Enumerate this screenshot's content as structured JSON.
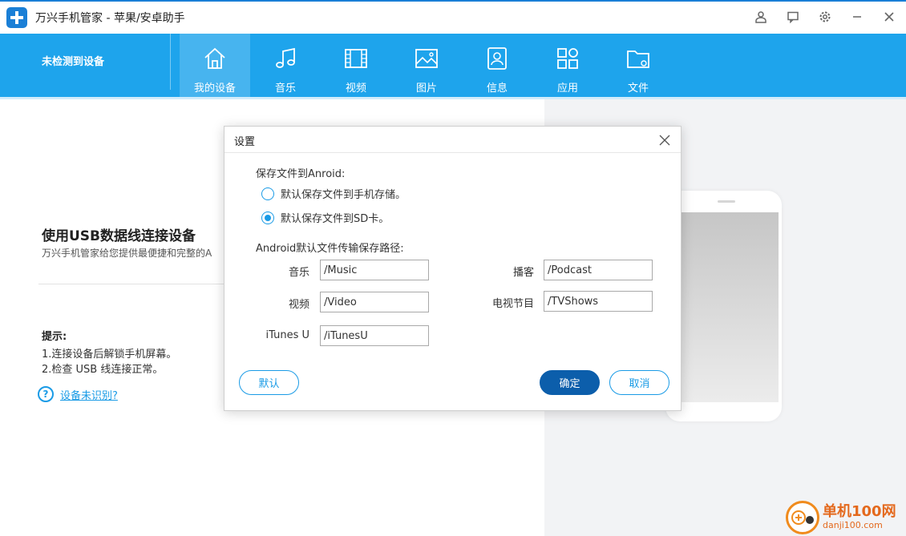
{
  "app": {
    "title": "万兴手机管家 - 苹果/安卓助手"
  },
  "window_controls": [
    {
      "name": "account-icon"
    },
    {
      "name": "feedback-icon"
    },
    {
      "name": "settings-icon"
    },
    {
      "name": "minimize-icon"
    },
    {
      "name": "close-icon"
    }
  ],
  "navbar": {
    "device_status": "未检测到设备",
    "tabs": [
      {
        "label": "我的设备",
        "icon": "home-icon",
        "active": true
      },
      {
        "label": "音乐",
        "icon": "music-icon",
        "active": false
      },
      {
        "label": "视频",
        "icon": "video-icon",
        "active": false
      },
      {
        "label": "图片",
        "icon": "photo-icon",
        "active": false
      },
      {
        "label": "信息",
        "icon": "contacts-icon",
        "active": false
      },
      {
        "label": "应用",
        "icon": "apps-icon",
        "active": false
      },
      {
        "label": "文件",
        "icon": "folder-icon",
        "active": false
      }
    ]
  },
  "main": {
    "connect_title": "使用USB数据线连接设备",
    "connect_desc": "万兴手机管家给您提供最便捷和完整的A",
    "tips_title": "提示:",
    "tips": [
      "1.连接设备后解锁手机屏幕。",
      "2.检查 USB 线连接正常。"
    ],
    "help_link": "设备未识别?"
  },
  "dialog": {
    "title": "设置",
    "save_section_label": "保存文件到Anroid:",
    "radio_options": [
      {
        "label": "默认保存文件到手机存储。",
        "checked": false
      },
      {
        "label": "默认保存文件到SD卡。",
        "checked": true
      }
    ],
    "path_section_label": "Android默认文件传输保存路径:",
    "fields": {
      "music": {
        "label": "音乐",
        "value": "/Music"
      },
      "video": {
        "label": "视频",
        "value": "/Video"
      },
      "itunesu": {
        "label": "iTunes U",
        "value": "/iTunesU"
      },
      "podcast": {
        "label": "播客",
        "value": "/Podcast"
      },
      "tvshows": {
        "label": "电视节目",
        "value": "/TVShows"
      }
    },
    "buttons": {
      "default": "默认",
      "ok": "确定",
      "cancel": "取消"
    }
  },
  "watermark": {
    "cn": "单机100网",
    "en": "danji100.com"
  },
  "colors": {
    "nav_bg": "#1ea4ec",
    "accent": "#1a9be6",
    "primary_button": "#0c5eab"
  }
}
